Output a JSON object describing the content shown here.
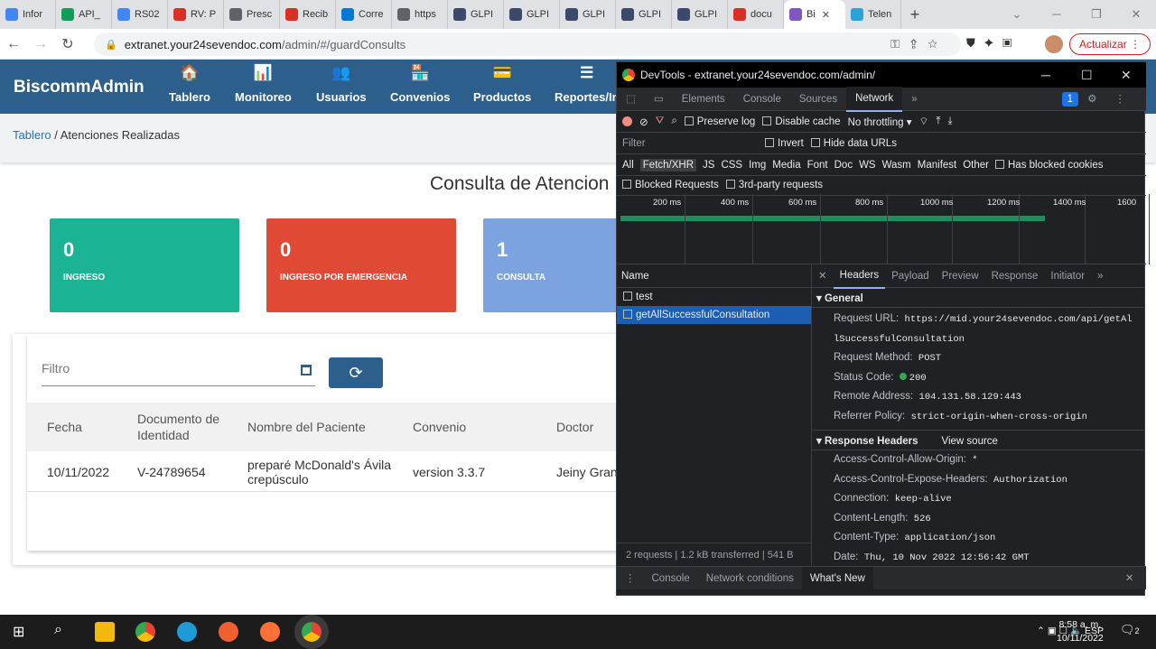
{
  "browser": {
    "tabs": [
      {
        "label": "Infor",
        "color": "#4285f4"
      },
      {
        "label": "API_",
        "color": "#0f9d58"
      },
      {
        "label": "RS02",
        "color": "#4285f4"
      },
      {
        "label": "RV: P",
        "color": "#d93025"
      },
      {
        "label": "Presc",
        "color": "#5f6368"
      },
      {
        "label": "Recib",
        "color": "#d93025"
      },
      {
        "label": "Corre",
        "color": "#0078d4"
      },
      {
        "label": "https",
        "color": "#5f6368"
      },
      {
        "label": "GLPI",
        "color": "#3b4a6b"
      },
      {
        "label": "GLPI",
        "color": "#3b4a6b"
      },
      {
        "label": "GLPI",
        "color": "#3b4a6b"
      },
      {
        "label": "GLPI",
        "color": "#3b4a6b"
      },
      {
        "label": "GLPI",
        "color": "#3b4a6b"
      },
      {
        "label": "docu",
        "color": "#d93025"
      }
    ],
    "active_tab": "Bi",
    "last_tab": "Telen",
    "url_host": "extranet.your24sevendoc.com",
    "url_path": "/admin/#/guardConsults",
    "update_label": "Actualizar"
  },
  "app": {
    "brand": "BiscommAdmin",
    "nav": [
      {
        "label": "Tablero",
        "icon": "🏠"
      },
      {
        "label": "Monitoreo",
        "icon": "📊"
      },
      {
        "label": "Usuarios",
        "icon": "👥"
      },
      {
        "label": "Convenios",
        "icon": "🏪"
      },
      {
        "label": "Productos",
        "icon": "💳"
      },
      {
        "label": "Reportes/In",
        "icon": "☰"
      }
    ],
    "breadcrumb_link": "Tablero",
    "breadcrumb_current": " / Atenciones Realizadas",
    "page_title": "Consulta de Atencion",
    "cards": [
      {
        "value": "0",
        "label": "INGRESO",
        "color": "#1ab394"
      },
      {
        "value": "0",
        "label": "INGRESO POR EMERGENCIA",
        "color": "#e04a35"
      },
      {
        "value": "1",
        "label": "CONSULTA",
        "color": "#7ba3e0"
      }
    ],
    "filter_placeholder": "Filtro",
    "table": {
      "headers": [
        "Fecha",
        "Documento de Identidad",
        "Nombre del Paciente",
        "Convenio",
        "Doctor"
      ],
      "rows": [
        [
          "10/11/2022",
          "V-24789654",
          "preparé McDonald's Ávila crepúsculo",
          "version 3.3.7",
          "Jeiny Gran"
        ]
      ]
    }
  },
  "devtools": {
    "title": "DevTools - extranet.your24sevendoc.com/admin/",
    "tabs": [
      "Elements",
      "Console",
      "Sources",
      "Network"
    ],
    "active_tab": "Network",
    "badge": "1",
    "toolbar": {
      "preserve_log": "Preserve log",
      "disable_cache": "Disable cache",
      "throttling": "No throttling"
    },
    "filter_placeholder": "Filter",
    "invert": "Invert",
    "hide_data_urls": "Hide data URLs",
    "type_filters": [
      "All",
      "Fetch/XHR",
      "JS",
      "CSS",
      "Img",
      "Media",
      "Font",
      "Doc",
      "WS",
      "Wasm",
      "Manifest",
      "Other"
    ],
    "has_blocked_cookies": "Has blocked cookies",
    "blocked_requests": "Blocked Requests",
    "third_party": "3rd-party requests",
    "timeline_ticks": [
      "200 ms",
      "400 ms",
      "600 ms",
      "800 ms",
      "1000 ms",
      "1200 ms",
      "1400 ms",
      "1600"
    ],
    "name_header": "Name",
    "requests": [
      "test",
      "getAllSuccessfulConsultation"
    ],
    "summary": "2 requests  |  1.2 kB transferred  |  541 B",
    "detail_tabs": [
      "Headers",
      "Payload",
      "Preview",
      "Response",
      "Initiator"
    ],
    "general_label": "General",
    "general": [
      {
        "k": "Request URL:",
        "v": "https://mid.your24sevendoc.com/api/getAl"
      },
      {
        "k": "",
        "v": "lSuccessfulConsultation"
      },
      {
        "k": "Request Method:",
        "v": "POST"
      },
      {
        "k": "Status Code:",
        "v": "200"
      },
      {
        "k": "Remote Address:",
        "v": "104.131.58.129:443"
      },
      {
        "k": "Referrer Policy:",
        "v": "strict-origin-when-cross-origin"
      }
    ],
    "response_headers_label": "Response Headers",
    "view_source": "View source",
    "response_headers": [
      {
        "k": "Access-Control-Allow-Origin:",
        "v": "*"
      },
      {
        "k": "Access-Control-Expose-Headers:",
        "v": "Authorization"
      },
      {
        "k": "Connection:",
        "v": "keep-alive"
      },
      {
        "k": "Content-Length:",
        "v": "526"
      },
      {
        "k": "Content-Type:",
        "v": "application/json"
      },
      {
        "k": "Date:",
        "v": "Thu, 10 Nov 2022 12:56:42 GMT"
      }
    ],
    "drawer_tabs": [
      "Console",
      "Network conditions",
      "What's New"
    ]
  },
  "taskbar": {
    "lang": "ESP",
    "time": "8:58 a. m.",
    "date": "10/11/2022",
    "notif": "2"
  }
}
